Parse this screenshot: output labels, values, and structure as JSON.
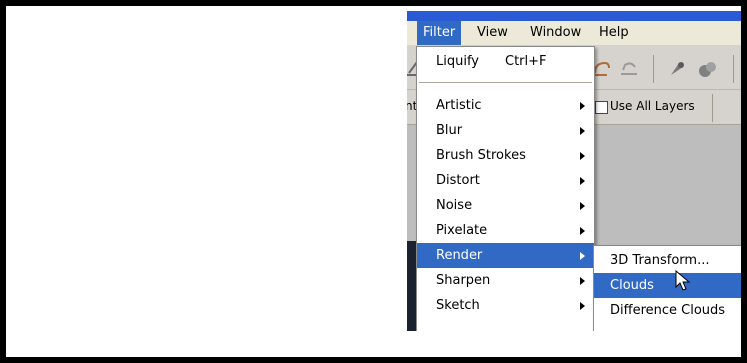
{
  "menubar": {
    "items": [
      {
        "label": "Filter",
        "active": true
      },
      {
        "label": "View",
        "active": false
      },
      {
        "label": "Window",
        "active": false
      },
      {
        "label": "Help",
        "active": false
      }
    ]
  },
  "options_bar": {
    "partial_label": "nt",
    "use_all_layers_label": "Use All Layers",
    "use_all_layers_checked": false
  },
  "filter_menu": {
    "last_filter": {
      "label": "Liquify",
      "shortcut": "Ctrl+F"
    },
    "items": [
      {
        "label": "Artistic",
        "submenu": true
      },
      {
        "label": "Blur",
        "submenu": true
      },
      {
        "label": "Brush Strokes",
        "submenu": true
      },
      {
        "label": "Distort",
        "submenu": true
      },
      {
        "label": "Noise",
        "submenu": true
      },
      {
        "label": "Pixelate",
        "submenu": true
      },
      {
        "label": "Render",
        "submenu": true,
        "highlighted": true
      },
      {
        "label": "Sharpen",
        "submenu": true
      },
      {
        "label": "Sketch",
        "submenu": true
      }
    ]
  },
  "render_submenu": {
    "items": [
      {
        "label": "3D Transform...",
        "highlighted": false
      },
      {
        "label": "Clouds",
        "highlighted": true
      },
      {
        "label": "Difference Clouds",
        "highlighted": false
      }
    ]
  },
  "colors": {
    "highlight": "#316ac5",
    "menubar": "#ece9d8",
    "titlebar": "#2a5ad4"
  }
}
